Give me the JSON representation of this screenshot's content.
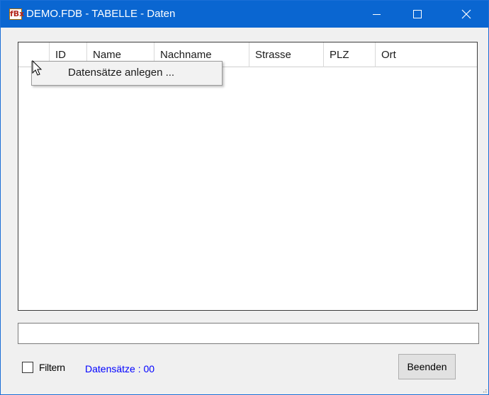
{
  "window": {
    "title": "DEMO.FDB - TABELLE - Daten",
    "app_icon": "fBx"
  },
  "titlebar_buttons": {
    "minimize_icon": "minimize-icon",
    "maximize_icon": "maximize-icon",
    "close_icon": "close-icon"
  },
  "grid": {
    "columns": [
      "",
      "ID",
      "Name",
      "Nachname",
      "Strasse",
      "PLZ",
      "Ort"
    ],
    "rows": []
  },
  "context_menu": {
    "items": [
      "Datensätze anlegen ..."
    ]
  },
  "status_field": {
    "value": ""
  },
  "footer": {
    "filter_label": "Filtern",
    "filter_checked": false,
    "record_count": "Datensätze : 00",
    "close_button": "Beenden"
  },
  "colors": {
    "titlebar": "#0a66d1",
    "record_count": "#0000ff"
  }
}
